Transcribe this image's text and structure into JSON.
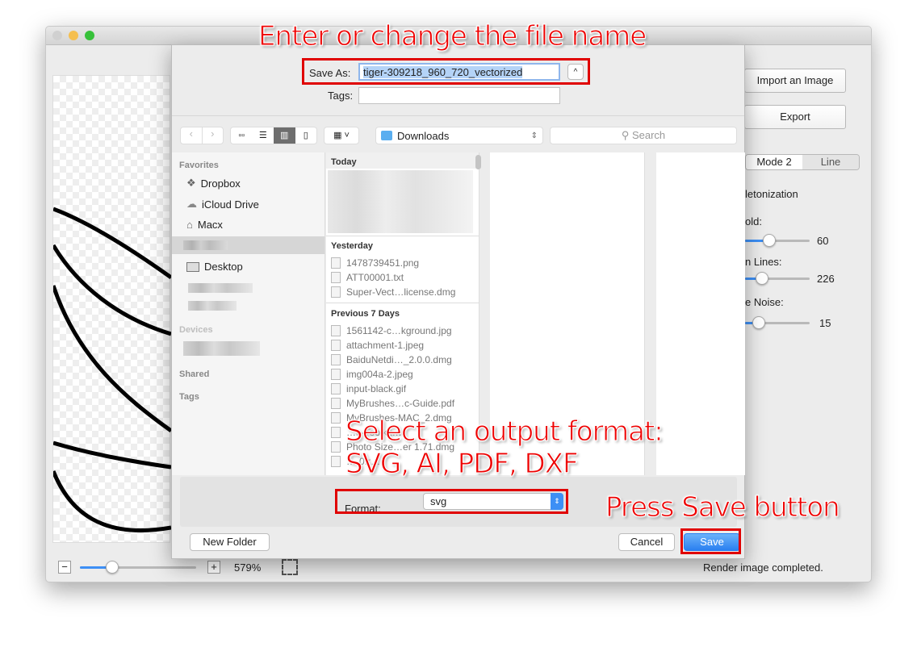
{
  "annotations": {
    "top": "Enter or change the file name",
    "middle_line1": "Select an output format:",
    "middle_line2": "SVG, AI, PDF, DXF",
    "right": "Press Save button"
  },
  "app": {
    "buttons": {
      "import": "Import an Image",
      "export": "Export"
    },
    "modes": [
      "Mode 2",
      "Line"
    ],
    "option_label": "letonization",
    "sliders": [
      {
        "label": "old:",
        "value": "60",
        "fraction": 0.35
      },
      {
        "label": "n Lines:",
        "value": "226",
        "fraction": 0.25
      },
      {
        "label": "e Noise:",
        "value": "15",
        "fraction": 0.2
      }
    ],
    "zoom": {
      "value": "579%",
      "fraction": 0.27
    },
    "status": "Render image completed."
  },
  "dialog": {
    "save_as_label": "Save As:",
    "filename": "tiger-309218_960_720_vectorized",
    "tags_label": "Tags:",
    "tags_value": "",
    "location": "Downloads",
    "search_placeholder": "Search",
    "sidebar": {
      "favorites": "Favorites",
      "items": [
        "Dropbox",
        "iCloud Drive",
        "Macx",
        "Desktop"
      ],
      "devices": "Devices",
      "shared": "Shared",
      "tags": "Tags"
    },
    "groups": [
      {
        "label": "Today",
        "files": []
      },
      {
        "label": "Yesterday",
        "files": [
          "1478739451.png",
          "ATT00001.txt",
          "Super-Vect…license.dmg"
        ]
      },
      {
        "label": "Previous 7 Days",
        "files": [
          "1561142-c…kground.jpg",
          "attachment-1.jpeg",
          "BaiduNetdi…_2.0.0.dmg",
          "img004a-2.jpeg",
          "input-black.gif",
          "MyBrushes…c-Guide.pdf",
          "MyBrushes-MAC_2.dmg",
          "…n-Toolkit…",
          "Photo Size…er 1.71.dmg",
          "…-0.r…"
        ]
      }
    ],
    "format_label": "Format:",
    "format_value": "svg",
    "new_folder": "New Folder",
    "cancel": "Cancel",
    "save": "Save"
  },
  "colors": {
    "accent": "#3d8ff5",
    "annotation": "#e00000"
  }
}
